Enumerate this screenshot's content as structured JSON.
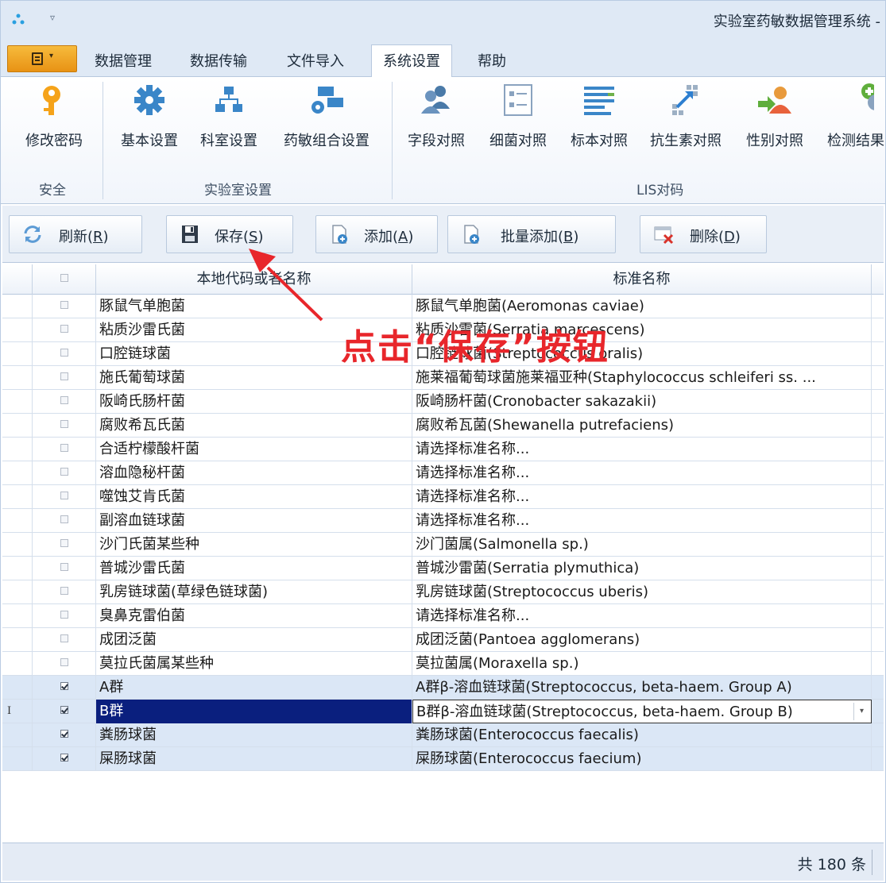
{
  "window": {
    "title": "实验室药敏数据管理系统 -"
  },
  "tabs": [
    {
      "label": "数据管理",
      "active": false
    },
    {
      "label": "数据传输",
      "active": false
    },
    {
      "label": "文件导入",
      "active": false
    },
    {
      "label": "系统设置",
      "active": true
    },
    {
      "label": "帮助",
      "active": false
    }
  ],
  "ribbon": {
    "groups": [
      {
        "label": "安全",
        "buttons": [
          {
            "label": "修改密码",
            "icon": "key-icon"
          }
        ]
      },
      {
        "label": "实验室设置",
        "buttons": [
          {
            "label": "基本设置",
            "icon": "gear-icon"
          },
          {
            "label": "科室设置",
            "icon": "org-chart-icon"
          },
          {
            "label": "药敏组合设置",
            "icon": "combo-settings-icon"
          }
        ]
      },
      {
        "label": "LIS对码",
        "buttons": [
          {
            "label": "字段对照",
            "icon": "users-icon"
          },
          {
            "label": "细菌对照",
            "icon": "list-icon"
          },
          {
            "label": "标本对照",
            "icon": "lines-icon"
          },
          {
            "label": "抗生素对照",
            "icon": "expand-icon"
          },
          {
            "label": "性别对照",
            "icon": "person-arrow-icon"
          },
          {
            "label": "检测结果",
            "icon": "add-remove-icon"
          }
        ]
      }
    ]
  },
  "toolbar": {
    "refresh": {
      "text": "刷新(",
      "key": "R",
      "end": ")"
    },
    "save": {
      "text": "保存(",
      "key": "S",
      "end": ")"
    },
    "add": {
      "text": "添加(",
      "key": "A",
      "end": ")"
    },
    "batch_add": {
      "text": "批量添加(",
      "key": "B",
      "end": ")"
    },
    "delete": {
      "text": "删除(",
      "key": "D",
      "end": ")"
    }
  },
  "grid": {
    "columns": {
      "local": "本地代码或者名称",
      "standard": "标准名称"
    },
    "rows": [
      {
        "checked": false,
        "local": "豚鼠气单胞菌",
        "standard": "豚鼠气单胞菌(Aeromonas caviae)"
      },
      {
        "checked": false,
        "local": "粘质沙雷氏菌",
        "standard": "粘质沙雷菌(Serratia marcescens)"
      },
      {
        "checked": false,
        "local": "口腔链球菌",
        "standard": "口腔链球菌(Streptococcus oralis)"
      },
      {
        "checked": false,
        "local": "施氏葡萄球菌",
        "standard": "施莱福葡萄球菌施莱福亚种(Staphylococcus schleiferi ss. ..."
      },
      {
        "checked": false,
        "local": "阪崎氏肠杆菌",
        "standard": "阪崎肠杆菌(Cronobacter sakazakii)"
      },
      {
        "checked": false,
        "local": "腐败希瓦氏菌",
        "standard": "腐败希瓦菌(Shewanella putrefaciens)"
      },
      {
        "checked": false,
        "local": "合适柠檬酸杆菌",
        "standard": "请选择标准名称..."
      },
      {
        "checked": false,
        "local": "溶血隐秘杆菌",
        "standard": "请选择标准名称..."
      },
      {
        "checked": false,
        "local": "噬蚀艾肯氏菌",
        "standard": "请选择标准名称..."
      },
      {
        "checked": false,
        "local": "副溶血链球菌",
        "standard": "请选择标准名称..."
      },
      {
        "checked": false,
        "local": "沙门氏菌某些种",
        "standard": "沙门菌属(Salmonella sp.)"
      },
      {
        "checked": false,
        "local": "普城沙雷氏菌",
        "standard": "普城沙雷菌(Serratia plymuthica)"
      },
      {
        "checked": false,
        "local": "乳房链球菌(草绿色链球菌)",
        "standard": "乳房链球菌(Streptococcus uberis)"
      },
      {
        "checked": false,
        "local": "臭鼻克雷伯菌",
        "standard": "请选择标准名称..."
      },
      {
        "checked": false,
        "local": "成团泛菌",
        "standard": "成团泛菌(Pantoea agglomerans)"
      },
      {
        "checked": false,
        "local": "莫拉氏菌属某些种",
        "standard": "莫拉菌属(Moraxella sp.)"
      },
      {
        "checked": true,
        "local": "A群",
        "standard": "A群β-溶血链球菌(Streptococcus, beta-haem. Group A)"
      },
      {
        "checked": true,
        "selected": true,
        "indicator": "I",
        "local": "B群",
        "standard": "B群β-溶血链球菌(Streptococcus, beta-haem. Group B)"
      },
      {
        "checked": true,
        "local": "粪肠球菌",
        "standard": "粪肠球菌(Enterococcus faecalis)"
      },
      {
        "checked": true,
        "local": "屎肠球菌",
        "standard": "屎肠球菌(Enterococcus faecium)"
      }
    ]
  },
  "footer": {
    "count": "共 180 条"
  },
  "annotation": {
    "text": "点击“保存”按钮",
    "color": "#e8262b"
  }
}
